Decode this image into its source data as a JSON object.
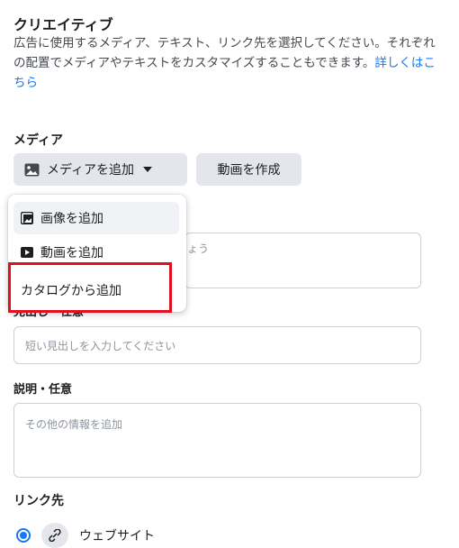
{
  "creative": {
    "title": "クリエイティブ",
    "description": "広告に使用するメディア、テキスト、リンク先を選択してください。それぞれの配置でメディアやテキストをカスタマイズすることもできます。",
    "learn_more": "詳しくはこちら"
  },
  "media": {
    "label": "メディア",
    "add_media_button": "メディアを追加",
    "create_video_button": "動画を作成",
    "menu": [
      {
        "label": "画像を追加",
        "icon": "image-icon"
      },
      {
        "label": "動画を追加",
        "icon": "video-icon"
      },
      {
        "label": "カタログから追加",
        "icon": "none"
      }
    ]
  },
  "primary_text": {
    "placeholder_fragment": "ょう"
  },
  "headline": {
    "label_fragment": "見出し・任意",
    "placeholder": "短い見出しを入力してください"
  },
  "description_field": {
    "label": "説明・任意",
    "placeholder": "その他の情報を追加"
  },
  "destination": {
    "label": "リンク先",
    "option_label": "ウェブサイト"
  },
  "colors": {
    "accent": "#1877f2",
    "highlight": "#e0101e"
  }
}
